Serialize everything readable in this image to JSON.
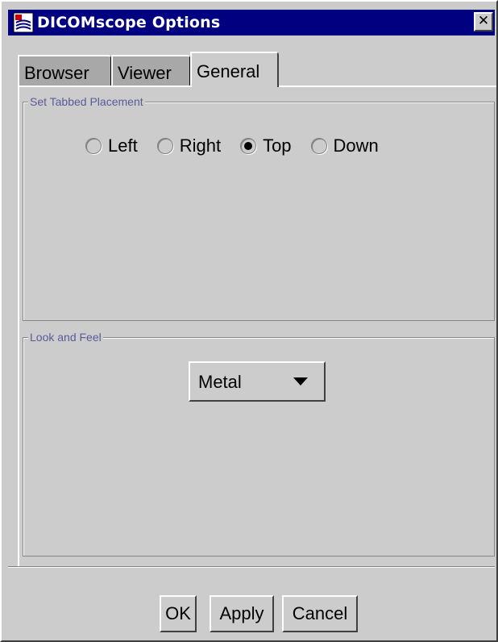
{
  "window": {
    "title": "DICOMscope Options",
    "close_glyph": "✕",
    "app_icon": "dicomscope-app-icon",
    "titlebar_color": "#000080"
  },
  "tabs": [
    {
      "label": "Browser",
      "selected": false
    },
    {
      "label": "Viewer",
      "selected": false
    },
    {
      "label": "General",
      "selected": true
    }
  ],
  "placement_group": {
    "title": "Set Tabbed Placement",
    "options": [
      {
        "label": "Left",
        "checked": false
      },
      {
        "label": "Right",
        "checked": false
      },
      {
        "label": "Top",
        "checked": true
      },
      {
        "label": "Down",
        "checked": false
      }
    ]
  },
  "laf_group": {
    "title": "Look and Feel",
    "selected_value": "Metal"
  },
  "buttons": {
    "ok": "OK",
    "apply": "Apply",
    "cancel": "Cancel"
  },
  "colors": {
    "background": "#cccccc",
    "group_title": "#5a5a9a"
  }
}
